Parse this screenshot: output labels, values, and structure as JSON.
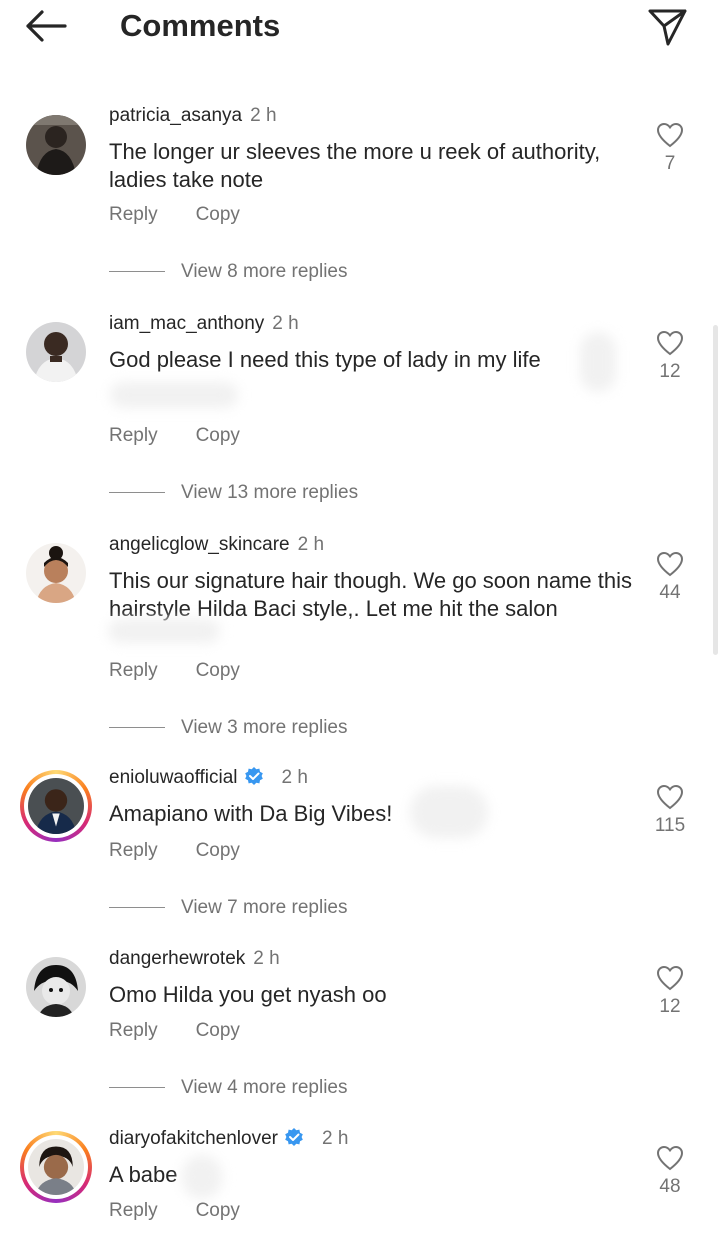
{
  "header": {
    "title": "Comments"
  },
  "comments": [
    {
      "username": "patricia_asanya",
      "time": "2 h",
      "verified": false,
      "text": "The longer ur sleeves the more u reek of authority, ladies take note",
      "likes": "7",
      "reply_label": "Reply",
      "copy_label": "Copy",
      "replies_label": "View 8 more replies"
    },
    {
      "username": "iam_mac_anthony",
      "time": "2 h",
      "verified": false,
      "text": "God please I need this type of lady in my life",
      "likes": "12",
      "reply_label": "Reply",
      "copy_label": "Copy",
      "replies_label": "View 13 more replies"
    },
    {
      "username": "angelicglow_skincare",
      "time": "2 h",
      "verified": false,
      "text": "This our signature hair though. We go soon name this hairstyle Hilda Baci style,. Let me hit the salon",
      "likes": "44",
      "reply_label": "Reply",
      "copy_label": "Copy",
      "replies_label": "View 3 more replies"
    },
    {
      "username": "enioluwaofficial",
      "time": "2 h",
      "verified": true,
      "text": "Amapiano with Da Big Vibes!",
      "likes": "115",
      "reply_label": "Reply",
      "copy_label": "Copy",
      "replies_label": "View 7 more replies"
    },
    {
      "username": "dangerhewrotek",
      "time": "2 h",
      "verified": false,
      "text": "Omo Hilda you get nyash oo",
      "likes": "12",
      "reply_label": "Reply",
      "copy_label": "Copy",
      "replies_label": "View 4 more replies"
    },
    {
      "username": "diaryofakitchenlover",
      "time": "2 h",
      "verified": true,
      "text": "A babe",
      "likes": "48",
      "reply_label": "Reply",
      "copy_label": "Copy"
    }
  ],
  "colors": {
    "text": "#262626",
    "secondary": "#737373",
    "verified": "#3897f0"
  },
  "icons": {
    "back": "arrow-left-icon",
    "send": "paper-plane-icon",
    "like": "heart-outline-icon",
    "verified": "verified-badge-icon"
  }
}
